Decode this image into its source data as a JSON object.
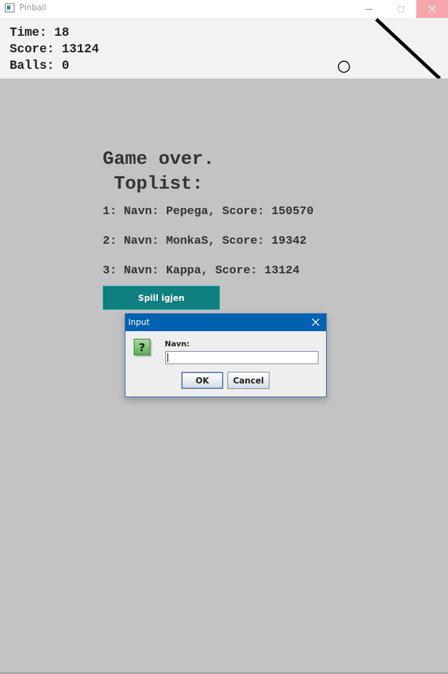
{
  "window": {
    "title": "Pinball",
    "icon": "app-window-icon",
    "controls": [
      "minimize-icon",
      "maximize-icon",
      "close-icon"
    ],
    "close_hover_color": "#f4a6ac"
  },
  "hud": {
    "time": "Time: 18",
    "score": "Score: 13124",
    "balls": "Balls: 0"
  },
  "game_over": {
    "title_line1": "Game over.",
    "title_line2": " Toplist:",
    "toplist": [
      "1: Navn: Pepega, Score: 150570",
      "2: Navn: MonkaS, Score: 19342",
      "3: Navn: Kappa, Score: 13124"
    ],
    "play_again_label": "Spill igjen",
    "accent_color": "#0f7f7f"
  },
  "dialog": {
    "title": "Input",
    "icon": "question-icon",
    "icon_text": "?",
    "prompt": "Navn:",
    "input_value": "",
    "ok_label": "OK",
    "cancel_label": "Cancel",
    "title_color": "#0061b0"
  }
}
